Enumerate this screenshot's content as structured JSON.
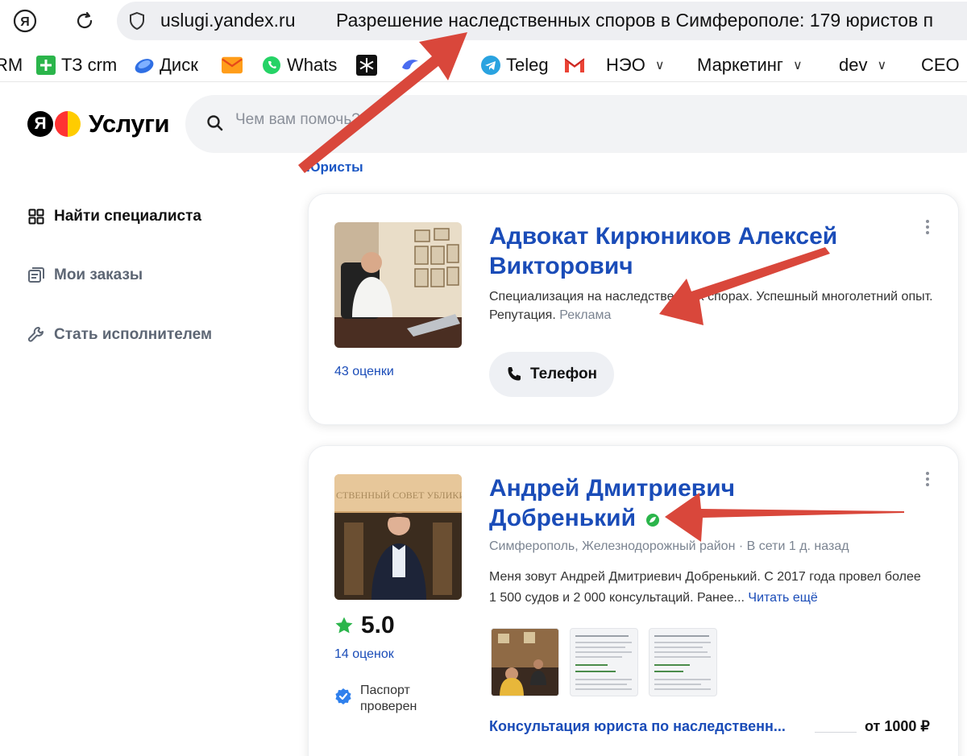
{
  "browser": {
    "host": "uslugi.yandex.ru",
    "page_title": "Разрешение наследственных споров в Симферополе: 179 юристов п"
  },
  "bookmarks": [
    {
      "label": "RM",
      "icon": "bookmark-crm-icon"
    },
    {
      "label": "ТЗ crm",
      "icon": "green-plus-icon"
    },
    {
      "label": "Диск",
      "icon": "yandex-disk-icon"
    },
    {
      "label": "",
      "icon": "mail-envelope-icon"
    },
    {
      "label": "Whats",
      "icon": "whatsapp-icon"
    },
    {
      "label": "",
      "icon": "snowflake-icon"
    },
    {
      "label": "",
      "icon": "blue-wing-icon"
    },
    {
      "label": "Teleg",
      "icon": "telegram-icon"
    },
    {
      "label": "",
      "icon": "gmail-icon"
    },
    {
      "label": "НЭО",
      "icon": "folder-icon"
    },
    {
      "label": "Маркетинг",
      "icon": "folder-icon"
    },
    {
      "label": "dev",
      "icon": "folder-icon"
    },
    {
      "label": "CEO",
      "icon": "folder-icon"
    }
  ],
  "header": {
    "logo_letter": "Я",
    "logo_text": "Услуги",
    "search_placeholder": "Чем вам помочь?"
  },
  "breadcrumb": "Юристы",
  "sidebar": {
    "items": [
      {
        "label": "Найти специалиста",
        "icon": "grid-icon"
      },
      {
        "label": "Мои заказы",
        "icon": "orders-icon"
      },
      {
        "label": "Стать исполнителем",
        "icon": "wrench-icon"
      }
    ]
  },
  "cards": [
    {
      "name_line1": "Адвокат Кирюников Алексей",
      "name_line2": "Викторович",
      "description": "Специализация на наследственных спорах. Успешный многолетний опыт. Репутация.",
      "ad_label": "Реклама",
      "ratings": "43 оценки",
      "phone_label": "Телефон"
    },
    {
      "name_line1": "Андрей Дмитриевич",
      "name_line2": "Добренький",
      "location": "Симферополь, Железнодорожный район",
      "online": "В сети 1 д. назад",
      "description": "Меня зовут Андрей Дмитриевич Добренький. С 2017 года провел более 1 500 судов и 2 000 консультаций. Ранее...",
      "read_more": "Читать ещё",
      "score": "5.0",
      "ratings": "14 оценок",
      "passport_line1": "Паспорт",
      "passport_line2": "проверен",
      "photo_banner": "СТВЕННЫЙ СОВЕТ  УБЛИКИ КРЫМ",
      "service": "Консультация юриста по наследственн...",
      "price": "от 1000 ₽"
    }
  ],
  "colors": {
    "link_blue": "#1a4cb8",
    "annotation_red": "#d9473b",
    "star_green": "#2bb54b",
    "verified_blue": "#2f80ed"
  }
}
